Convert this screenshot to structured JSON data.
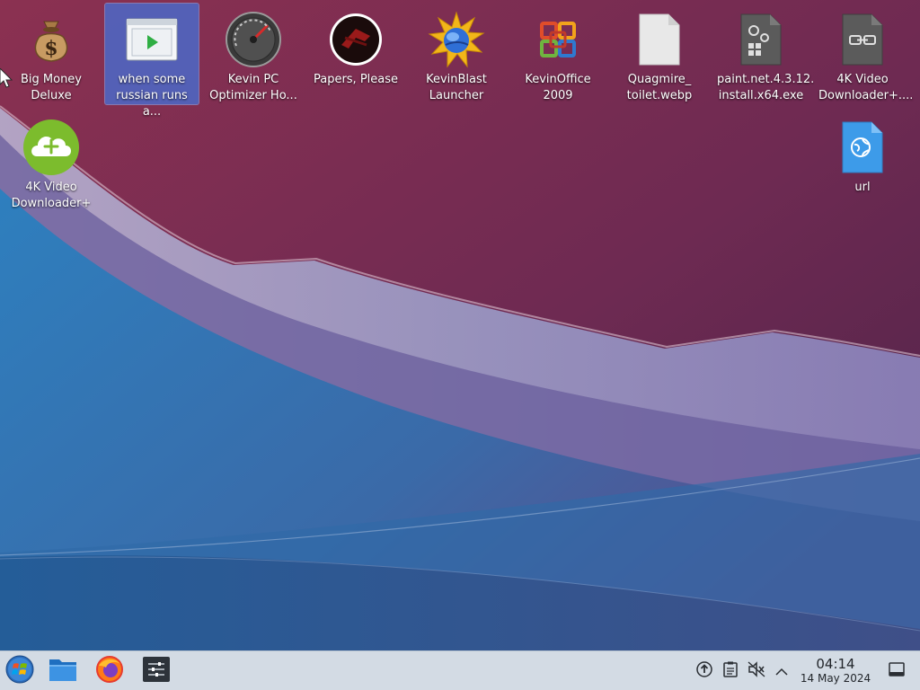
{
  "desktop": {
    "icons": [
      {
        "label": "Big Money\nDeluxe",
        "icon": "money-bag-icon",
        "selected": false
      },
      {
        "label": "when some\nrussian runs a...",
        "icon": "video-file-icon",
        "selected": true
      },
      {
        "label": "Kevin PC\nOptimizer Ho...",
        "icon": "speedometer-icon",
        "selected": false
      },
      {
        "label": "Papers, Please",
        "icon": "papers-please-emblem-icon",
        "selected": false
      },
      {
        "label": "KevinBlast\nLauncher",
        "icon": "sunburst-globe-icon",
        "selected": false
      },
      {
        "label": "KevinOffice\n2009",
        "icon": "office-logo-icon",
        "selected": false
      },
      {
        "label": "Quagmire_\ntoilet.webp",
        "icon": "blank-file-icon",
        "selected": false
      },
      {
        "label": "paint.net.4.3.12.\ninstall.x64.exe",
        "icon": "executable-file-icon",
        "selected": false
      },
      {
        "label": "4K Video\nDownloader+....",
        "icon": "link-file-icon",
        "selected": false
      },
      {
        "label": "4K Video\nDownloader+",
        "icon": "cloud-download-icon",
        "selected": false
      },
      {
        "label": "url",
        "icon": "web-link-file-icon",
        "selected": false
      }
    ]
  },
  "taskbar": {
    "launchers": [
      {
        "name": "start-menu-button",
        "icon": "start-orb-icon"
      },
      {
        "name": "file-manager-button",
        "icon": "folder-icon"
      },
      {
        "name": "firefox-button",
        "icon": "firefox-icon"
      },
      {
        "name": "mixer-button",
        "icon": "mixer-icon"
      }
    ],
    "tray": [
      {
        "name": "updates-tray-icon",
        "icon": "upload-arrow-icon"
      },
      {
        "name": "clipboard-tray-icon",
        "icon": "clipboard-icon"
      },
      {
        "name": "volume-tray-icon",
        "icon": "speaker-muted-icon"
      },
      {
        "name": "show-hidden-icons-button",
        "icon": "chevron-up-icon"
      }
    ],
    "clock": {
      "time": "04:14",
      "date": "14 May 2024"
    },
    "show_desktop_icon": "show-desktop-icon"
  },
  "colors": {
    "taskbar": "#d3dbe4",
    "selection": "#466ed2",
    "wallpaper_purple": "#6e2a52",
    "wallpaper_blue": "#2d7ab8"
  }
}
